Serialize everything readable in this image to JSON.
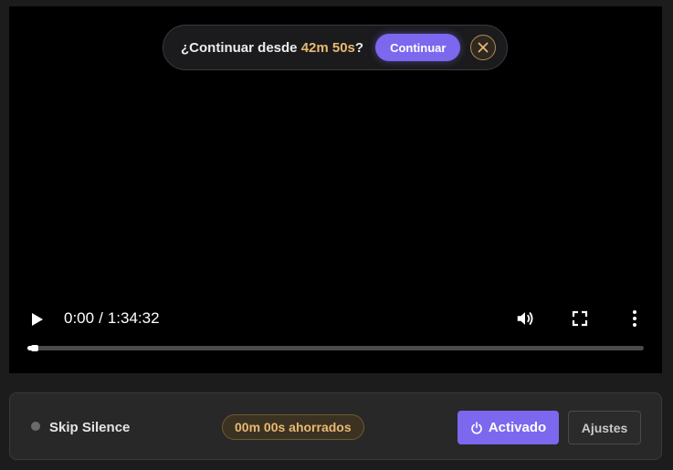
{
  "resume_prompt": {
    "prefix": "¿Continuar desde ",
    "time": "42m 50s",
    "suffix": "?",
    "continue_label": "Continuar",
    "close_icon": "close-icon"
  },
  "player": {
    "current_time": "0:00",
    "separator": "/",
    "duration": "1:34:32",
    "progress_fraction": 0.006,
    "icons": {
      "play": "play-icon",
      "volume": "volume-icon",
      "fullscreen": "fullscreen-icon",
      "more": "more-options-icon"
    }
  },
  "skip_silence": {
    "title": "Skip Silence",
    "saved": "00m 00s ahorrados",
    "activate_label": "Activado",
    "activate_icon": "power-icon",
    "settings_label": "Ajustes"
  },
  "colors": {
    "accent": "#7b68ee",
    "highlight": "#e9b872",
    "background": "#1c1c1c"
  }
}
